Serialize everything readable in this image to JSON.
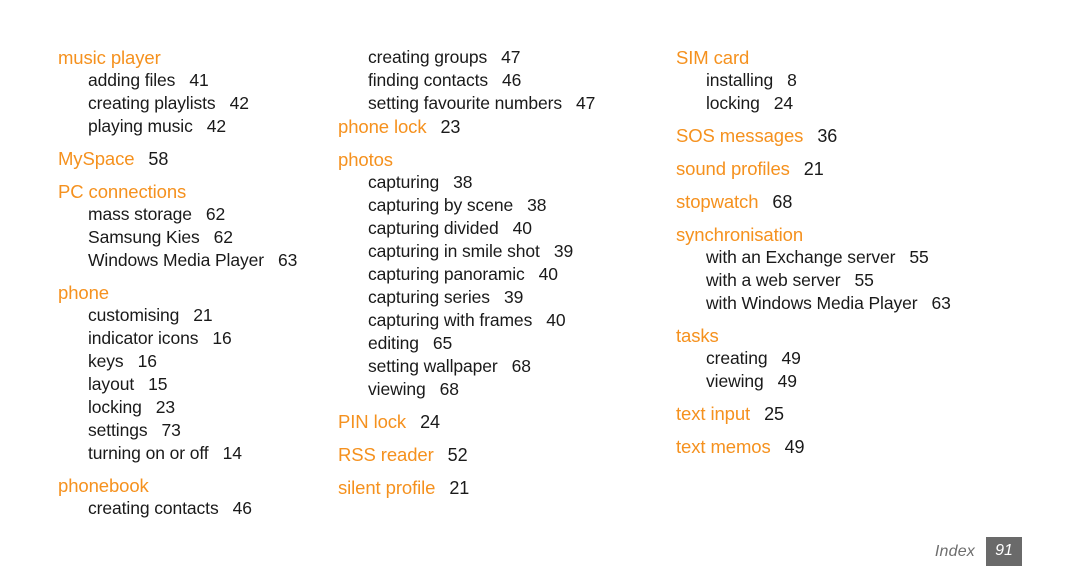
{
  "colors": {
    "heading": "#f5911e",
    "body": "#1a1a1a",
    "footer_text": "#6e6e6e",
    "footer_box_bg": "#6a6a6a",
    "footer_box_text": "#ffffff",
    "background": "#ffffff"
  },
  "footer": {
    "label": "Index",
    "page_number": "91"
  },
  "columns": [
    {
      "id": "column-1",
      "groups": [
        {
          "heading": {
            "label": "music player",
            "page": ""
          },
          "entries": [
            {
              "label": "adding files",
              "page": "41"
            },
            {
              "label": "creating playlists",
              "page": "42"
            },
            {
              "label": "playing music",
              "page": "42"
            }
          ]
        },
        {
          "heading": {
            "label": "MySpace",
            "page": "58"
          },
          "entries": []
        },
        {
          "heading": {
            "label": "PC connections",
            "page": ""
          },
          "entries": [
            {
              "label": "mass storage",
              "page": "62"
            },
            {
              "label": "Samsung Kies",
              "page": "62"
            },
            {
              "label": "Windows Media Player",
              "page": "63"
            }
          ]
        },
        {
          "heading": {
            "label": "phone",
            "page": ""
          },
          "entries": [
            {
              "label": "customising",
              "page": "21"
            },
            {
              "label": "indicator icons",
              "page": "16"
            },
            {
              "label": "keys",
              "page": "16"
            },
            {
              "label": "layout",
              "page": "15"
            },
            {
              "label": "locking",
              "page": "23"
            },
            {
              "label": "settings",
              "page": "73"
            },
            {
              "label": "turning on or off",
              "page": "14"
            }
          ]
        },
        {
          "heading": {
            "label": "phonebook",
            "page": ""
          },
          "entries": [
            {
              "label": "creating contacts",
              "page": "46"
            }
          ]
        }
      ]
    },
    {
      "id": "column-2",
      "groups": [
        {
          "heading": null,
          "entries": [
            {
              "label": "creating groups",
              "page": "47"
            },
            {
              "label": "finding contacts",
              "page": "46"
            },
            {
              "label": "setting favourite numbers",
              "page": "47"
            }
          ]
        },
        {
          "heading": {
            "label": "phone lock",
            "page": "23"
          },
          "entries": []
        },
        {
          "heading": {
            "label": "photos",
            "page": ""
          },
          "entries": [
            {
              "label": "capturing",
              "page": "38"
            },
            {
              "label": "capturing by scene",
              "page": "38"
            },
            {
              "label": "capturing divided",
              "page": "40"
            },
            {
              "label": "capturing in smile shot",
              "page": "39"
            },
            {
              "label": "capturing panoramic",
              "page": "40"
            },
            {
              "label": "capturing series",
              "page": "39"
            },
            {
              "label": "capturing with frames",
              "page": "40"
            },
            {
              "label": "editing",
              "page": "65"
            },
            {
              "label": "setting wallpaper",
              "page": "68"
            },
            {
              "label": "viewing",
              "page": "68"
            }
          ]
        },
        {
          "heading": {
            "label": "PIN lock",
            "page": "24"
          },
          "entries": []
        },
        {
          "heading": {
            "label": "RSS reader",
            "page": "52"
          },
          "entries": []
        },
        {
          "heading": {
            "label": "silent profile",
            "page": "21"
          },
          "entries": []
        }
      ]
    },
    {
      "id": "column-3",
      "groups": [
        {
          "heading": {
            "label": "SIM card",
            "page": ""
          },
          "entries": [
            {
              "label": "installing",
              "page": "8"
            },
            {
              "label": "locking",
              "page": "24"
            }
          ]
        },
        {
          "heading": {
            "label": "SOS messages",
            "page": "36"
          },
          "entries": []
        },
        {
          "heading": {
            "label": "sound profiles",
            "page": "21"
          },
          "entries": []
        },
        {
          "heading": {
            "label": "stopwatch",
            "page": "68"
          },
          "entries": []
        },
        {
          "heading": {
            "label": "synchronisation",
            "page": ""
          },
          "entries": [
            {
              "label": "with an Exchange server",
              "page": "55"
            },
            {
              "label": "with a web server",
              "page": "55"
            },
            {
              "label": "with Windows Media Player",
              "page": "63"
            }
          ]
        },
        {
          "heading": {
            "label": "tasks",
            "page": ""
          },
          "entries": [
            {
              "label": "creating",
              "page": "49"
            },
            {
              "label": "viewing",
              "page": "49"
            }
          ]
        },
        {
          "heading": {
            "label": "text input",
            "page": "25"
          },
          "entries": []
        },
        {
          "heading": {
            "label": "text memos",
            "page": "49"
          },
          "entries": []
        }
      ]
    }
  ]
}
